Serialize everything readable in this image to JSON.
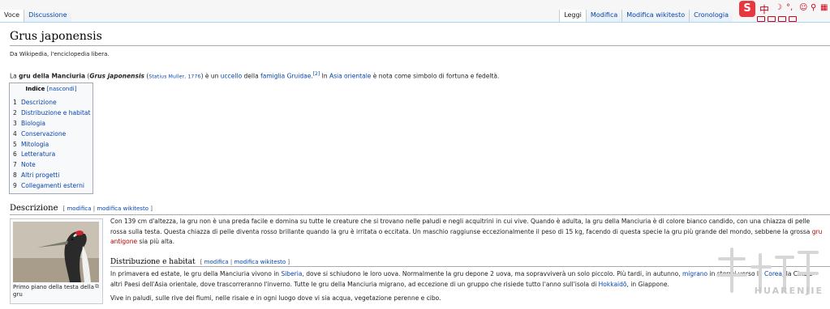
{
  "tabs_left": [
    "Voce",
    "Discussione"
  ],
  "tabs_right": [
    "Leggi",
    "Modifica",
    "Modifica wikitesto",
    "Cronologia"
  ],
  "toolbar": {
    "s": "S",
    "zh": "中"
  },
  "title": "Grus japonensis",
  "subtitle": "Da Wikipedia, l'enciclopedia libera.",
  "intro": {
    "p1": "La ",
    "bold": "gru della Manciuria",
    "p2": " (",
    "italic": "Grus japonensis",
    "p3": " (",
    "author": "Statius Muller, 1776",
    "p4": ") è un ",
    "l1": "uccello",
    "p5": " della ",
    "l2": "famiglia Gruidae",
    "p6": ".",
    "ref": "[2]",
    "p7": " In ",
    "l3": "Asia orientale",
    "p8": " è nota come simbolo di fortuna e fedeltà."
  },
  "toc": {
    "title": "Indice",
    "toggle": "[nascondi]",
    "items": [
      {
        "num": "1",
        "label": "Descrizione"
      },
      {
        "num": "2",
        "label": "Distribuzione e habitat"
      },
      {
        "num": "3",
        "label": "Biologia"
      },
      {
        "num": "4",
        "label": "Conservazione"
      },
      {
        "num": "5",
        "label": "Mitologia"
      },
      {
        "num": "6",
        "label": "Letteratura"
      },
      {
        "num": "7",
        "label": "Note"
      },
      {
        "num": "8",
        "label": "Altri progetti"
      },
      {
        "num": "9",
        "label": "Collegamenti esterni"
      }
    ]
  },
  "edit": {
    "open": "[ ",
    "modifica": "modifica",
    "sep": " | ",
    "wikitesto": "modifica wikitesto",
    "close": " ]"
  },
  "descrizione": {
    "heading": "Descrizione",
    "caption": "Primo piano della testa della gru",
    "text1": "Con 139 cm d'altezza, la gru non è una preda facile e domina su tutte le creature che si trovano nelle paludi e negli acquitrini in cui vive. Quando è adulta, la gru della Manciuria è di colore bianco candido, con una chiazza di pelle rossa sulla testa. Questa chiazza di pelle diventa rosso brillante quando la gru è irritata o eccitata. Un maschio raggiunse eccezionalmente il peso di 15 kg, facendo di questa specie la gru più grande del mondo, sebbene la grossa ",
    "link": "gru antigone",
    "text2": " sia più alta."
  },
  "distribuzione": {
    "heading": "Distribuzione e habitat",
    "t1": "In primavera ed estate, le gru della Manciuria vivono in ",
    "l1": "Siberia",
    "t2": ", dove si schiudono le loro uova. Normalmente la gru depone 2 uova, ma sopravviverà un solo piccolo. Più tardi, in autunno, ",
    "l2": "migrano",
    "t3": " in stormi verso la ",
    "l3": "Corea",
    "t4": ", la Cina e altri Paesi dell'Asia orientale, dove trascorreranno l'inverno. Tutte le gru della Manciuria migrano, ad eccezione di un gruppo che risiede tutto l'anno sull'isola di ",
    "l4": "Hokkaidō",
    "t5": ", in Giappone.",
    "p2": "Vive in paludi, sulle rive dei fiumi, nelle risaie e in ogni luogo dove vi sia acqua, vegetazione perenne e cibo."
  },
  "watermark": "HUARENJIE"
}
